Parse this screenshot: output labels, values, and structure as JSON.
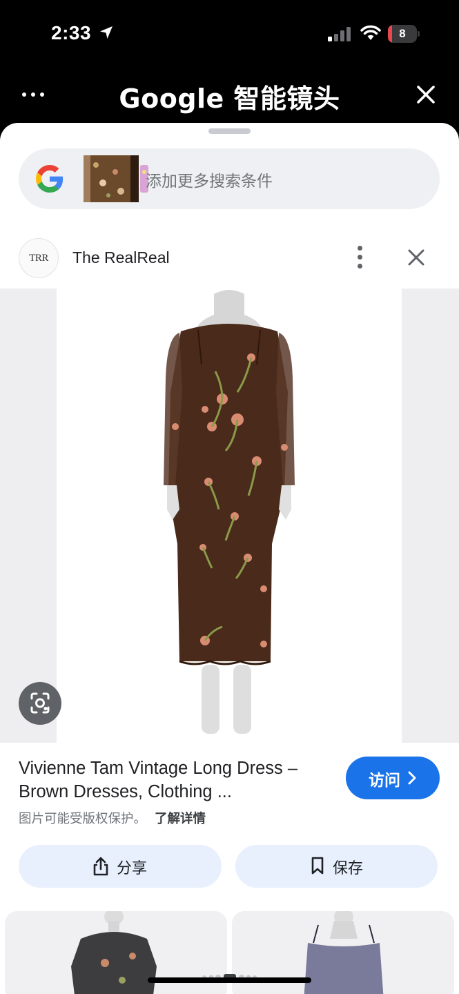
{
  "status_bar": {
    "time": "2:33",
    "battery_level": "8",
    "battery_fraction": 0.08,
    "battery_color": "#e5484d",
    "icons": [
      "location-arrow-icon",
      "cellular-signal-icon",
      "wifi-icon",
      "battery-icon"
    ]
  },
  "lens_header": {
    "title": "Google 智能镜头",
    "left_icon": "more-horizontal-icon",
    "right_icon": "close-icon"
  },
  "search": {
    "placeholder": "添加更多搜索条件",
    "logo": "google-g-icon"
  },
  "source": {
    "avatar_text": "TRR",
    "name": "The RealReal",
    "menu_icon": "more-vertical-icon",
    "close_icon": "close-icon"
  },
  "result": {
    "title": "Vivienne Tam Vintage Long Dress – Brown Dresses, Clothing ...",
    "visit_label": "访问",
    "copyright_note": "图片可能受版权保护。",
    "learn_more": "了解详情",
    "lens_icon": "lens-search-icon"
  },
  "actions": {
    "share_label": "分享",
    "save_label": "保存",
    "share_icon": "share-icon",
    "save_icon": "bookmark-icon"
  },
  "colors": {
    "accent": "#1a73e8",
    "action_bg": "#e8f0fe",
    "dress": "#4a2a1a"
  }
}
